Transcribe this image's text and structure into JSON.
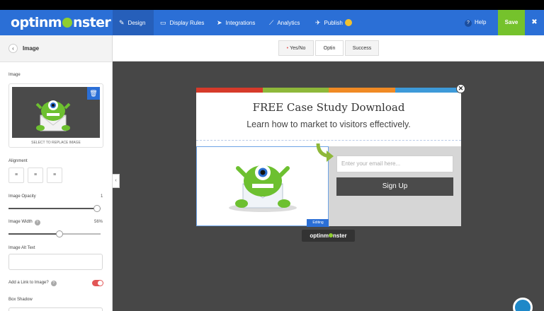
{
  "topbar": {
    "logo": "optinm",
    "logo_rest": "nster",
    "tabs": [
      {
        "label": "Design",
        "icon": "pencil-icon"
      },
      {
        "label": "Display Rules",
        "icon": "monitor-icon"
      },
      {
        "label": "Integrations",
        "icon": "paper-plane-icon"
      },
      {
        "label": "Analytics",
        "icon": "line-chart-icon"
      },
      {
        "label": "Publish",
        "icon": "rocket-icon"
      }
    ],
    "help": "Help",
    "save": "Save",
    "close_glyph": "✖"
  },
  "sidebar": {
    "title": "Image",
    "image_label": "Image",
    "replace_caption": "SELECT TO REPLACE IMAGE",
    "alignment_label": "Alignment",
    "opacity_label": "Image Opacity",
    "opacity_value": "1",
    "opacity_level": 1.0,
    "width_label": "Image Width",
    "width_value": "56%",
    "width_level": 0.56,
    "alt_label": "Image Alt Text",
    "alt_value": "",
    "link_label": "Add a Link to Image?",
    "link_enabled": false,
    "box_shadow_label": "Box Shadow"
  },
  "stage": {
    "segments": [
      {
        "label": "Yes/No",
        "dot": "•"
      },
      {
        "label": "Optin"
      },
      {
        "label": "Success"
      }
    ],
    "popup": {
      "title": "FREE Case Study Download",
      "subtitle": "Learn how to market to visitors effectively.",
      "email_placeholder": "Enter your email here...",
      "button": "Sign Up",
      "editing_badge": "Editing",
      "stripe_colors": [
        "#d63a2a",
        "#8eb83a",
        "#f08a24",
        "#3d9ad9"
      ]
    },
    "brand_tag": "optinm",
    "brand_tag_rest": "nster"
  },
  "colors": {
    "accent": "#2b6fd6",
    "save": "#75c22c",
    "monster": "#6dc030"
  }
}
